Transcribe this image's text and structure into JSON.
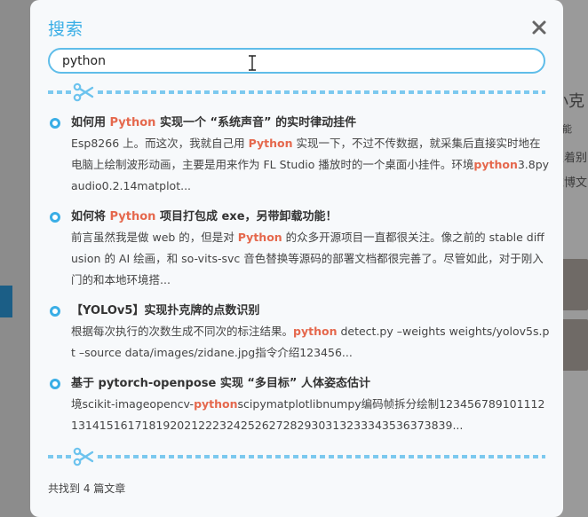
{
  "background": {
    "right_texts": [
      "小克",
      "智能",
      "很着别",
      "过博文"
    ]
  },
  "modal": {
    "title": "搜索",
    "search": {
      "value": "python"
    },
    "results": [
      {
        "title_parts": [
          {
            "text": "如何用 ",
            "hl": false
          },
          {
            "text": "Python",
            "hl": true
          },
          {
            "text": " 实现一个 “系统声音” 的实时律动挂件",
            "hl": false
          }
        ],
        "snippet_parts": [
          {
            "text": "Esp8266 上。而这次，我就自己用 ",
            "hl": false
          },
          {
            "text": "Python",
            "hl": true
          },
          {
            "text": " 实现一下，不过不传数据，就采集后直接实时地在电脑上绘制波形动画，主要是用来作为 FL Studio 播放时的一个桌面小挂件。环境",
            "hl": false
          },
          {
            "text": "python",
            "hl": true
          },
          {
            "text": "3.8pyaudio0.2.14matplot...",
            "hl": false
          }
        ]
      },
      {
        "title_parts": [
          {
            "text": "如何将 ",
            "hl": false
          },
          {
            "text": "Python",
            "hl": true
          },
          {
            "text": " 项目打包成 exe，另带卸载功能！",
            "hl": false
          }
        ],
        "snippet_parts": [
          {
            "text": "前言虽然我是做 web 的，但是对 ",
            "hl": false
          },
          {
            "text": "Python",
            "hl": true
          },
          {
            "text": " 的众多开源项目一直都很关注。像之前的 stable diffusion 的 AI 绘画，和 so-vits-svc 音色替换等源码的部署文档都很完善了。尽管如此，对于刚入门的和本地环境搭...",
            "hl": false
          }
        ]
      },
      {
        "title_parts": [
          {
            "text": "【YOLOv5】实现扑克牌的点数识别",
            "hl": false
          }
        ],
        "snippet_parts": [
          {
            "text": "根据每次执行的次数生成不同次的标注结果。",
            "hl": false
          },
          {
            "text": "python",
            "hl": true
          },
          {
            "text": " detect.py –weights weights/yolov5s.pt –source data/images/zidane.jpg指令介绍123456...",
            "hl": false
          }
        ]
      },
      {
        "title_parts": [
          {
            "text": "基于 pytorch-openpose 实现 “多目标” 人体姿态估计",
            "hl": false
          }
        ],
        "snippet_parts": [
          {
            "text": "境scikit-imageopencv-",
            "hl": false
          },
          {
            "text": "python",
            "hl": true
          },
          {
            "text": "scipymatplotlibnumpy编码帧拆分绘制123456789101112131415161718192021222324252627282930313233343536373839...",
            "hl": false
          }
        ]
      }
    ],
    "footer": "共找到 4 篇文章"
  },
  "colors": {
    "accent": "#3aaee6",
    "highlight": "#e5684d",
    "divider": "#7cc9ef"
  }
}
